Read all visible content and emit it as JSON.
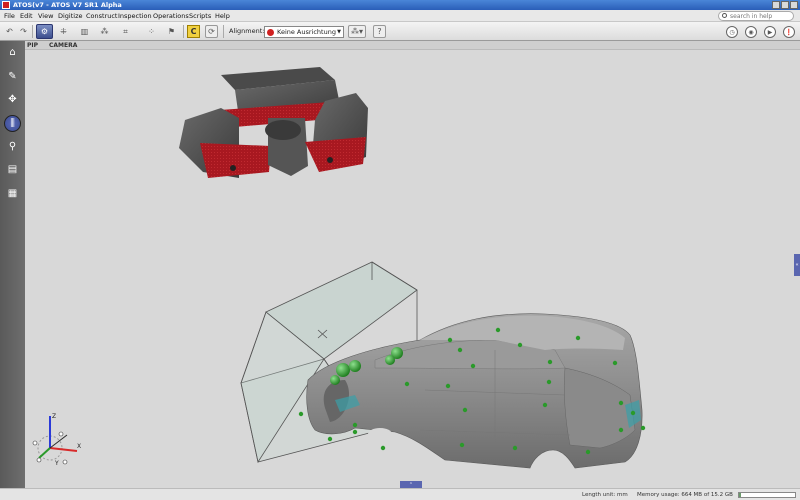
{
  "window": {
    "title": "ATOS(v7 - ATOS V7 SR1 Alpha"
  },
  "menu": {
    "items": [
      "File",
      "Edit",
      "View",
      "Digitize",
      "Construct",
      "Inspection",
      "Operations",
      "Scripts",
      "Help"
    ],
    "search_placeholder": "search in help"
  },
  "toolbar": {
    "alignment_label": "Alignment:",
    "alignment_value": "Keine Ausrichtung",
    "help_label": "?"
  },
  "viewport": {
    "tabs": [
      "PIP",
      "CAMERA"
    ]
  },
  "axes": {
    "x": "X",
    "y": "Y",
    "z": "Z"
  },
  "statusbar": {
    "length_unit": "Length unit:  mm",
    "memory_usage": "Memory usage:  664 MB of 15.2 GB",
    "memory_fraction": 0.043
  },
  "colors": {
    "accent": "#3d4f8e",
    "model_gray": "#8a8a8a",
    "reference_point": "#2a9a2a",
    "sensor_red": "#a81820"
  },
  "icons": {
    "sidebar": [
      "home-icon",
      "wrench-icon",
      "move-icon",
      "barcode-icon",
      "search-icon",
      "save-icon",
      "grid-icon"
    ]
  }
}
